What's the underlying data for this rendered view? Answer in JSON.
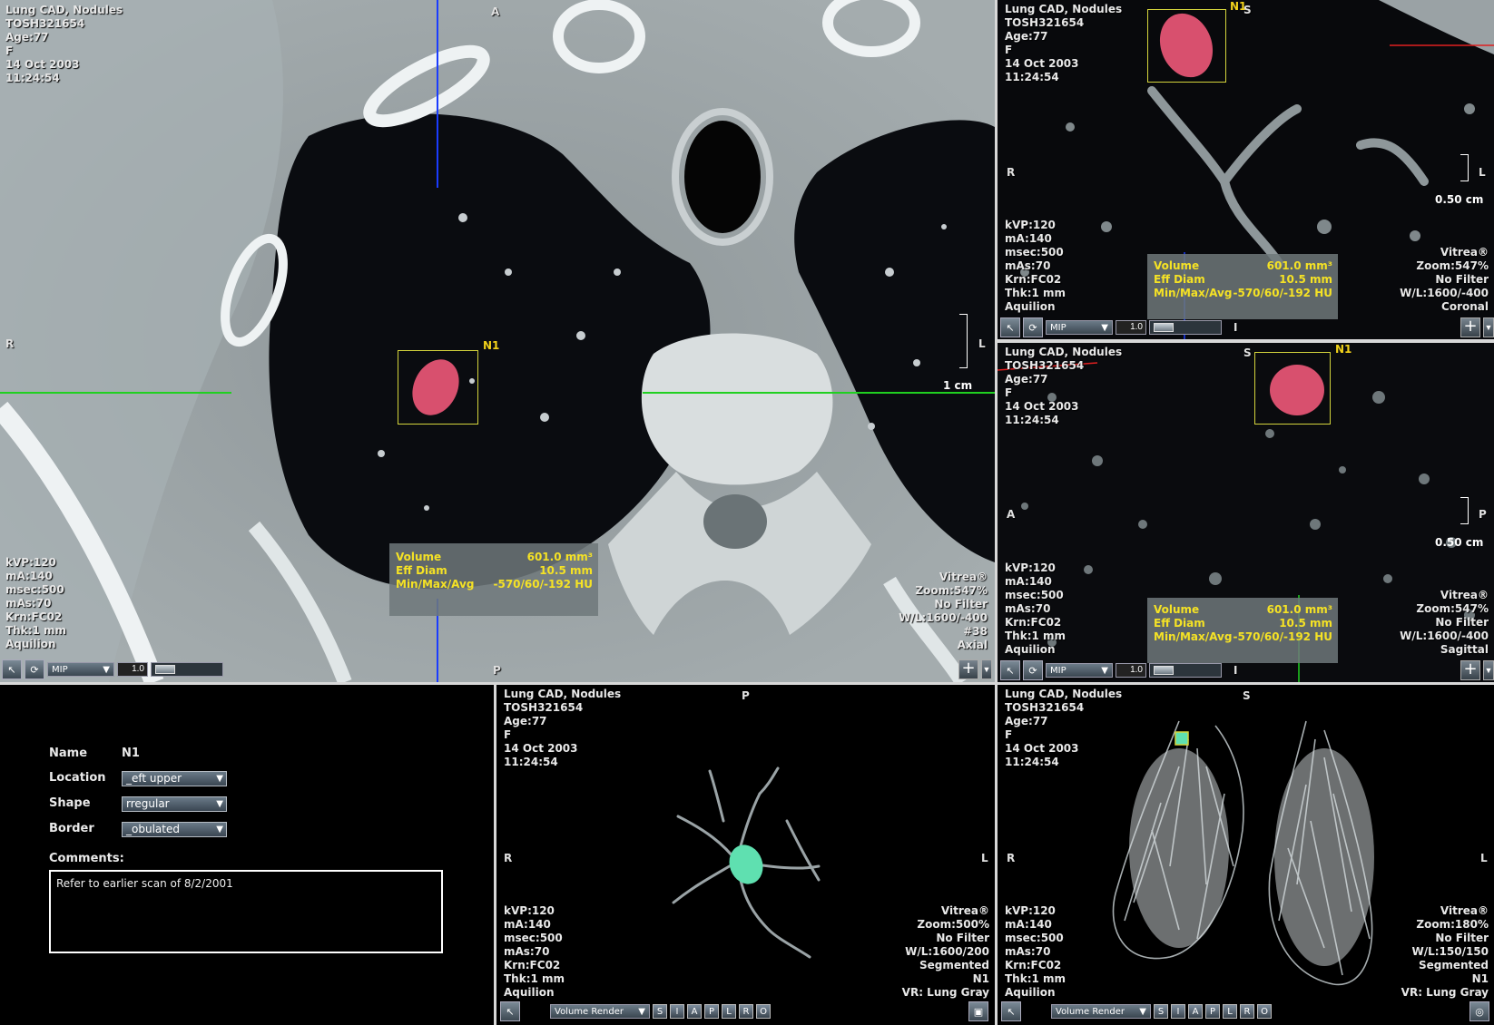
{
  "patient": {
    "study": "Lung CAD, Nodules",
    "id": "TOSH321654",
    "age": "Age:77",
    "sex": "F",
    "date": "14 Oct 2003",
    "time": "11:24:54"
  },
  "acq": {
    "kvp": "kVP:120",
    "ma": "mA:140",
    "msec": "msec:500",
    "mas": "mAs:70",
    "krn": "Krn:FC02",
    "thk": "Thk:1 mm",
    "scanner": "Aquilion"
  },
  "measurement": {
    "volume_label": "Volume",
    "volume_value": "601.0 mm³",
    "diam_label": "Eff Diam",
    "diam_value": "10.5 mm",
    "hu_label": "Min/Max/Avg",
    "hu_value": "-570/60/-192 HU"
  },
  "nodule_label": "N1",
  "viewports": {
    "axial": {
      "top": "A",
      "bottom": "P",
      "left": "R",
      "right": "L",
      "scale": "1 cm",
      "brand": "Vitrea®",
      "zoom": "Zoom:547%",
      "filter": "No Filter",
      "wl": "W/L:1600/-400",
      "slice": "#38",
      "plane": "Axial",
      "mode": "MIP",
      "thickness": "1.0"
    },
    "coronal": {
      "top": "S",
      "left": "R",
      "right": "L",
      "bottom": "I",
      "scale": "0.50 cm",
      "brand": "Vitrea®",
      "zoom": "Zoom:547%",
      "filter": "No Filter",
      "wl": "W/L:1600/-400",
      "plane": "Coronal",
      "mode": "MIP",
      "thickness": "1.0"
    },
    "sagittal": {
      "top": "S",
      "left": "A",
      "right": "P",
      "bottom": "I",
      "scale": "0.50 cm",
      "brand": "Vitrea®",
      "zoom": "Zoom:547%",
      "filter": "No Filter",
      "wl": "W/L:1600/-400",
      "plane": "Sagittal",
      "mode": "MIP",
      "thickness": "1.0"
    },
    "vr_nodule": {
      "top": "P",
      "left": "R",
      "right": "L",
      "brand": "Vitrea®",
      "zoom": "Zoom:500%",
      "filter": "No Filter",
      "wl": "W/L:1600/200",
      "seg": "Segmented",
      "nodule": "N1",
      "vr": "VR: Lung Gray",
      "mode": "Volume Render",
      "view_buttons": [
        "S",
        "I",
        "A",
        "P",
        "L",
        "R",
        "O"
      ]
    },
    "vr_lungs": {
      "top": "S",
      "left": "R",
      "right": "L",
      "brand": "Vitrea®",
      "zoom": "Zoom:180%",
      "filter": "No Filter",
      "wl": "W/L:150/150",
      "seg": "Segmented",
      "nodule": "N1",
      "vr": "VR: Lung Gray",
      "mode": "Volume Render",
      "view_buttons": [
        "S",
        "I",
        "A",
        "P",
        "L",
        "R",
        "O"
      ]
    }
  },
  "form": {
    "name_label": "Name",
    "name_value": "N1",
    "location_label": "Location",
    "location_value": "_eft upper",
    "shape_label": "Shape",
    "shape_value": "rregular",
    "border_label": "Border",
    "border_value": "_obulated",
    "comments_label": "Comments:",
    "comments_value": "Refer to earlier scan of 8/2/2001"
  },
  "colors": {
    "nodule": "#d8506e",
    "nodule_vr": "#5fe0b0",
    "crosshair_blue": "#1a3cff",
    "crosshair_green": "#20d020",
    "crosshair_red": "#e02020",
    "annotation_yellow": "#f5e225"
  }
}
